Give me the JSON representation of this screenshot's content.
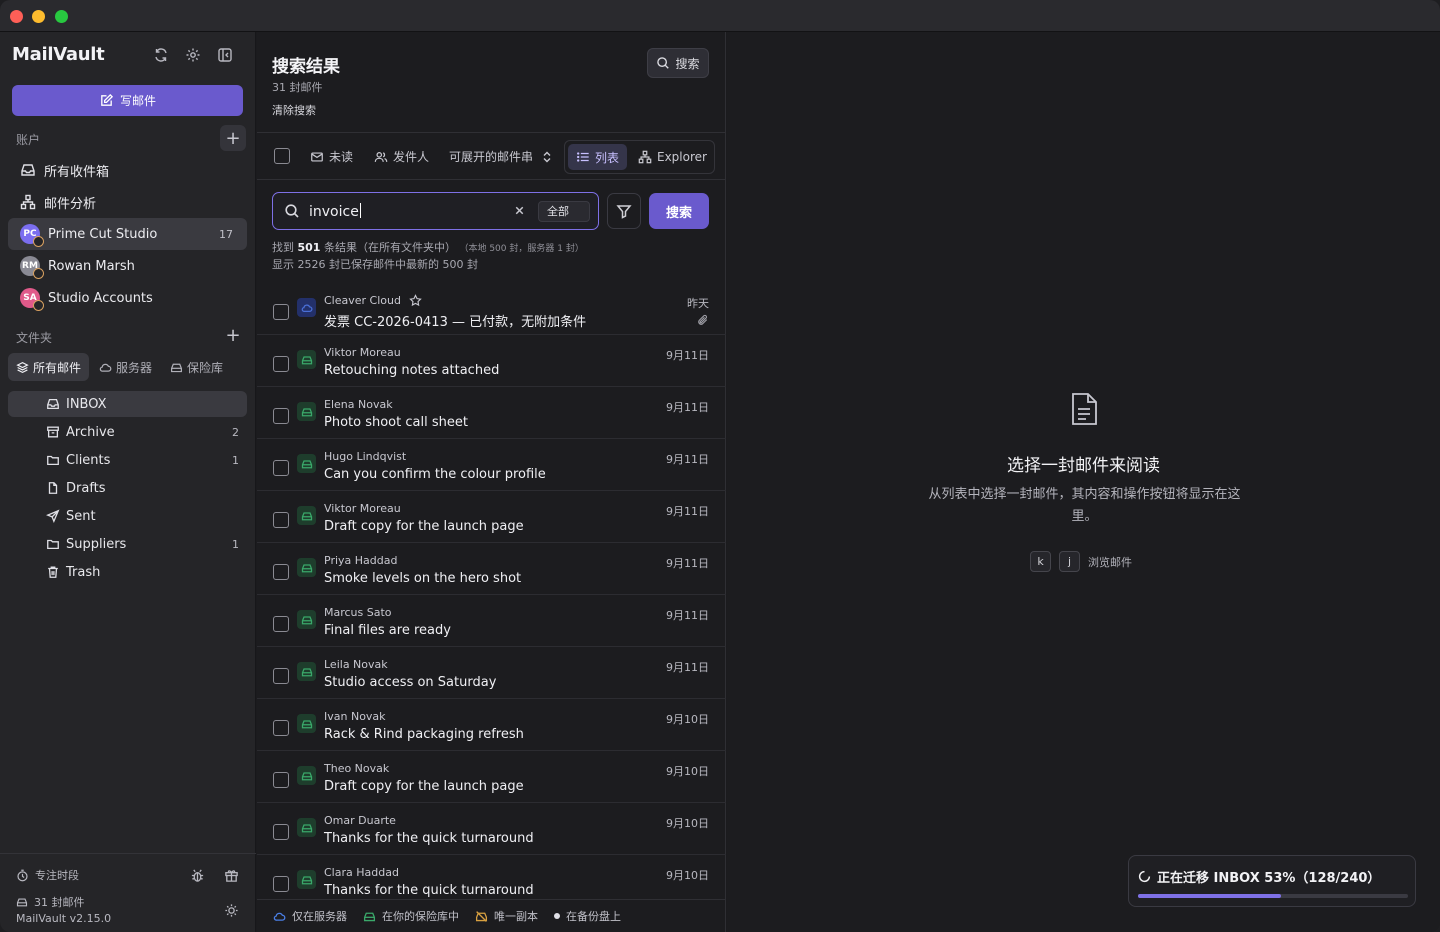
{
  "app": {
    "brand": "MailVault",
    "version": "MailVault v2.15.0"
  },
  "sidebar": {
    "compose_label": "写邮件",
    "accounts_label": "账户",
    "accounts": [
      {
        "label": "所有收件箱",
        "icon": "inbox-icon"
      },
      {
        "label": "邮件分析",
        "icon": "network-icon"
      },
      {
        "label": "Prime Cut Studio",
        "initials": "PC",
        "count": "17",
        "color": "#7b6ef0",
        "active": true
      },
      {
        "label": "Rowan Marsh",
        "initials": "RM",
        "color": "#8a8a94"
      },
      {
        "label": "Studio Accounts",
        "initials": "SA",
        "color": "#e05a8a"
      }
    ],
    "folders_label": "文件夹",
    "folder_tabs": [
      "所有邮件",
      "服务器",
      "保险库"
    ],
    "folders": [
      {
        "label": "INBOX",
        "icon": "inbox-icon",
        "count": "",
        "active": true
      },
      {
        "label": "Archive",
        "icon": "archive-icon",
        "count": "2"
      },
      {
        "label": "Clients",
        "icon": "folder-icon",
        "count": "1"
      },
      {
        "label": "Drafts",
        "icon": "file-icon",
        "count": ""
      },
      {
        "label": "Sent",
        "icon": "send-icon",
        "count": ""
      },
      {
        "label": "Suppliers",
        "icon": "folder-icon",
        "count": "1"
      },
      {
        "label": "Trash",
        "icon": "trash-icon",
        "count": ""
      }
    ],
    "footer": {
      "focus_label": "专注时段",
      "stat_label": "31 封邮件"
    }
  },
  "middle": {
    "title": "搜索结果",
    "subtitle": "31 封邮件",
    "clear_label": "清除搜索",
    "search_button": "搜索",
    "toolbar": {
      "unread": "未读",
      "sender": "发件人",
      "threads": "可展开的邮件串",
      "view_list": "列表",
      "view_explorer": "Explorer"
    },
    "search": {
      "value": "invoice",
      "scope": "全部",
      "go_label": "搜索"
    },
    "results": {
      "line1_pre": "找到 ",
      "line1_count": "501",
      "line1_post": " 条结果（在所有文件夹中）",
      "line1_small": "（本地 500 封，服务器 1 封）",
      "line2": "显示 2526 封已保存邮件中最新的 500 封"
    },
    "emails": [
      {
        "from": "Cleaver Cloud",
        "subject": "发票 CC-2026-0413 — 已付款，无附加条件",
        "date": "昨天",
        "source": "server",
        "star": true,
        "attachment": true
      },
      {
        "from": "Viktor Moreau",
        "subject": "Retouching notes attached",
        "date": "9月11日",
        "source": "vault"
      },
      {
        "from": "Elena Novak",
        "subject": "Photo shoot call sheet",
        "date": "9月11日",
        "source": "vault"
      },
      {
        "from": "Hugo Lindqvist",
        "subject": "Can you confirm the colour profile",
        "date": "9月11日",
        "source": "vault"
      },
      {
        "from": "Viktor Moreau",
        "subject": "Draft copy for the launch page",
        "date": "9月11日",
        "source": "vault"
      },
      {
        "from": "Priya Haddad",
        "subject": "Smoke levels on the hero shot",
        "date": "9月11日",
        "source": "vault"
      },
      {
        "from": "Marcus Sato",
        "subject": "Final files are ready",
        "date": "9月11日",
        "source": "vault"
      },
      {
        "from": "Leila Novak",
        "subject": "Studio access on Saturday",
        "date": "9月11日",
        "source": "vault"
      },
      {
        "from": "Ivan Novak",
        "subject": "Rack & Rind packaging refresh",
        "date": "9月10日",
        "source": "vault"
      },
      {
        "from": "Theo Novak",
        "subject": "Draft copy for the launch page",
        "date": "9月10日",
        "source": "vault"
      },
      {
        "from": "Omar Duarte",
        "subject": "Thanks for the quick turnaround",
        "date": "9月10日",
        "source": "vault"
      },
      {
        "from": "Clara Haddad",
        "subject": "Thanks for the quick turnaround",
        "date": "9月10日",
        "source": "vault"
      }
    ],
    "legend": [
      "仅在服务器",
      "在你的保险库中",
      "唯一副本",
      "在备份盘上"
    ]
  },
  "reader": {
    "empty_title": "选择一封邮件来阅读",
    "empty_desc": "从列表中选择一封邮件，其内容和操作按钮将显示在这里。",
    "key_k": "k",
    "key_j": "j",
    "key_hint": "浏览邮件"
  },
  "toast": {
    "text": "正在迁移 INBOX 53%（128/240）",
    "progress": 0.53
  },
  "colors": {
    "accent": "#6a5acd",
    "server": "#4a6fd6",
    "vault": "#3aa86a",
    "unique": "#d8a040"
  }
}
